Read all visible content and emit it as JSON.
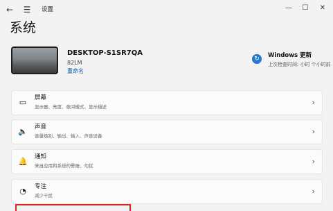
{
  "window": {
    "title": "设置",
    "back_icon": "←",
    "menu_icon": "☰",
    "minimize_icon": "—",
    "maximize_icon": "☐",
    "close_icon": "✕"
  },
  "page": {
    "title": "系统"
  },
  "device": {
    "name": "DESKTOP-S1SR7QA",
    "model": "82LM",
    "rename_label": "重命名"
  },
  "windows_update": {
    "icon": "↻",
    "title": "Windows 更新",
    "subtitle": "上次检查时间: 小时 个小时前"
  },
  "settings_items": [
    {
      "title": "屏幕",
      "subtitle": "显示器、亮度、夜间模式、显示描述",
      "icon": "▭",
      "chevron": "›"
    },
    {
      "title": "声音",
      "subtitle": "音量级别、输出、输入、声音设备",
      "icon": "🔈",
      "chevron": "›"
    },
    {
      "title": "通知",
      "subtitle": "来自应用和系统的警报、勿扰",
      "icon": "🔔",
      "chevron": "›"
    },
    {
      "title": "专注",
      "subtitle": "减少干扰",
      "icon": "◔",
      "chevron": "›"
    }
  ],
  "colors": {
    "background": "#f3f3f3",
    "card": "#fbfbfb",
    "accent": "#2a79c9",
    "highlight": "#d8261e"
  }
}
